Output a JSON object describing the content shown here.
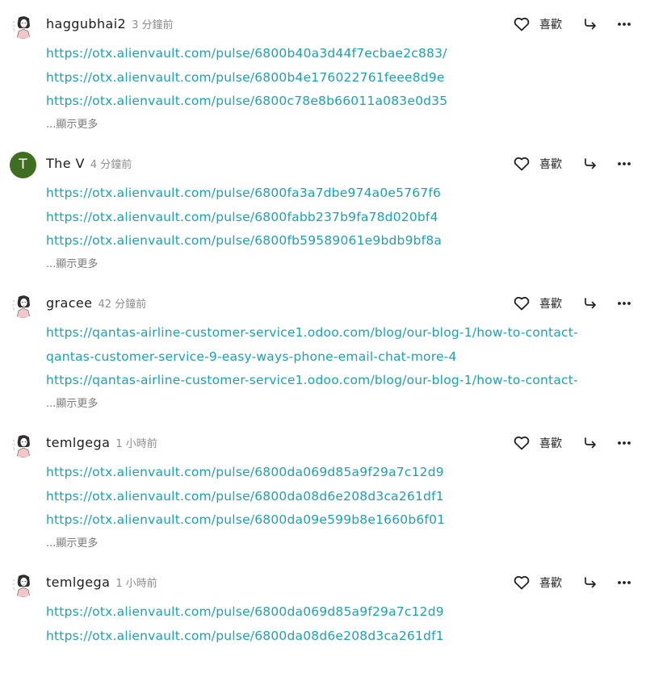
{
  "like_label": "喜歡",
  "show_more_label": "...顯示更多",
  "link_color": "#1aa2b3",
  "posts": [
    {
      "username": "haggubhai2",
      "time": "3 分鐘前",
      "avatar": "sketch-avatar",
      "links": [
        "https://otx.alienvault.com/pulse/6800b40a3d44f7ecbae2c883/",
        "https://otx.alienvault.com/pulse/6800b4e176022761feee8d9e",
        "https://otx.alienvault.com/pulse/6800c78e8b66011a083e0d35"
      ]
    },
    {
      "username": "The V",
      "time": "4 分鐘前",
      "avatar": "initial-avatar",
      "avatar_initial": "T",
      "avatar_color": "#3f6e20",
      "links": [
        "https://otx.alienvault.com/pulse/6800fa3a7dbe974a0e5767f6",
        "https://otx.alienvault.com/pulse/6800fabb237b9fa78d020bf4",
        "https://otx.alienvault.com/pulse/6800fb59589061e9bdb9bf8a"
      ]
    },
    {
      "username": "gracee",
      "time": "42 分鐘前",
      "avatar": "sketch-avatar",
      "links": [
        "https://qantas-airline-customer-service1.odoo.com/blog/our-blog-1/how-to-contact-",
        "qantas-customer-service-9-easy-ways-phone-email-chat-more-4",
        "https://qantas-airline-customer-service1.odoo.com/blog/our-blog-1/how-to-contact-"
      ]
    },
    {
      "username": "temlgega",
      "time": "1 小時前",
      "avatar": "sketch-avatar",
      "links": [
        "https://otx.alienvault.com/pulse/6800da069d85a9f29a7c12d9",
        "https://otx.alienvault.com/pulse/6800da08d6e208d3ca261df1",
        "https://otx.alienvault.com/pulse/6800da09e599b8e1660b6f01"
      ]
    },
    {
      "username": "temlgega",
      "time": "1 小時前",
      "avatar": "sketch-avatar",
      "links": [
        "https://otx.alienvault.com/pulse/6800da069d85a9f29a7c12d9",
        "https://otx.alienvault.com/pulse/6800da08d6e208d3ca261df1"
      ]
    }
  ]
}
